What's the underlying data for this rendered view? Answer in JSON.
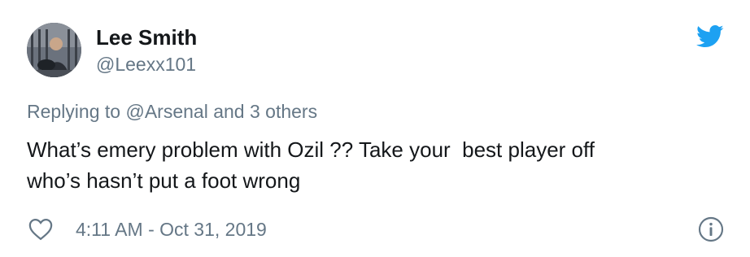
{
  "tweet": {
    "author": {
      "display_name": "Lee Smith",
      "handle": "@Leexx101",
      "avatar_icon": "avatar-photo"
    },
    "brand": {
      "icon": "twitter-bird-icon",
      "color": "#1da1f2"
    },
    "reply_prefix": "Replying to ",
    "reply_mention": "@Arsenal",
    "reply_suffix": " and 3 others",
    "text": "What’s emery problem with Ozil ?? Take your  best player off\nwho’s hasn’t put a foot wrong",
    "timestamp": "4:11 AM - Oct 31, 2019",
    "actions": {
      "like_icon": "heart-icon",
      "info_icon": "info-icon"
    },
    "colors": {
      "text": "#14171a",
      "secondary": "#657786"
    }
  }
}
